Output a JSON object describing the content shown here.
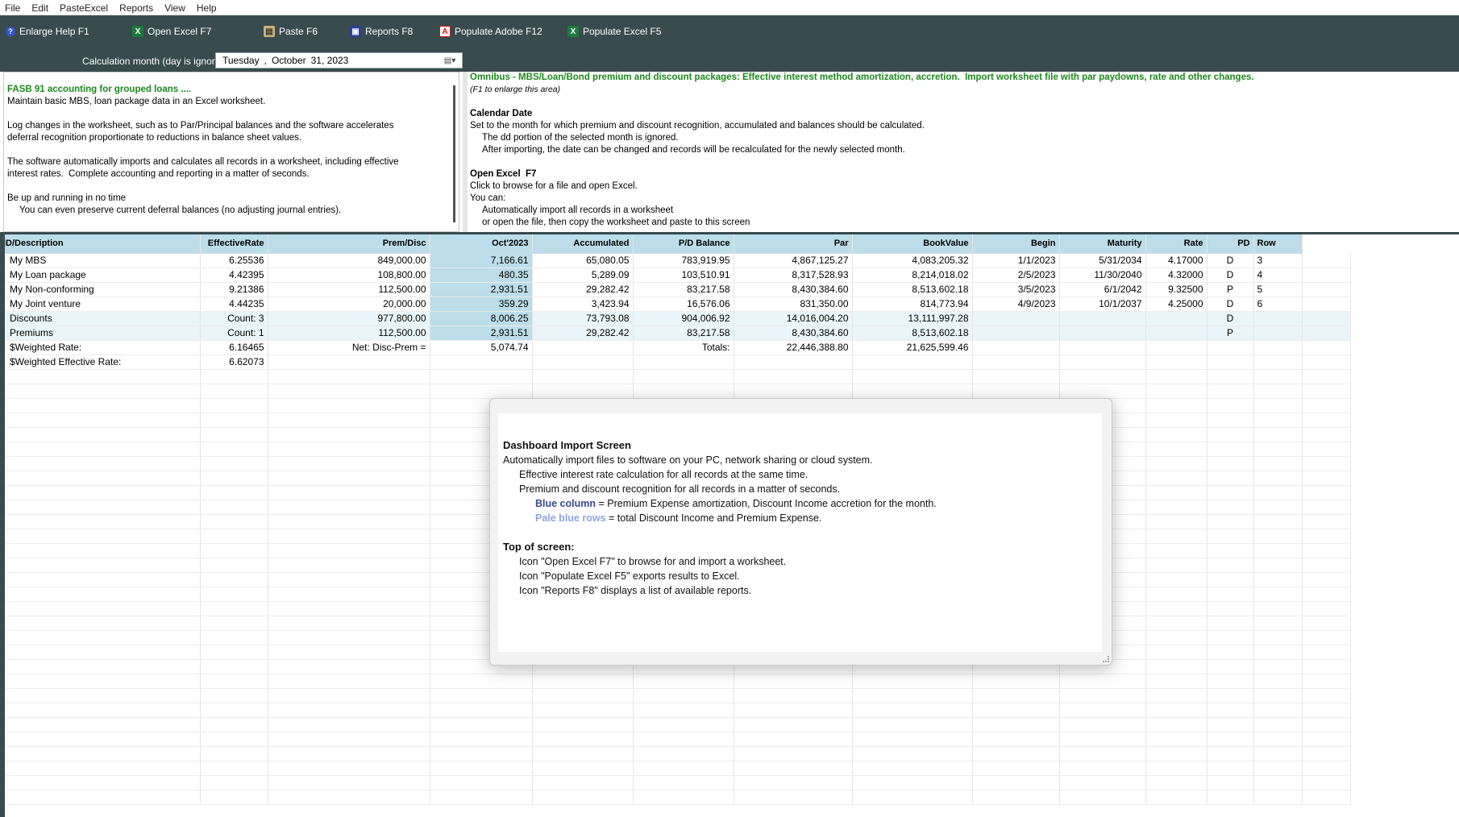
{
  "menu": [
    "File",
    "Edit",
    "PasteExcel",
    "Reports",
    "View",
    "Help"
  ],
  "toolbar": {
    "enlarge_help": "Enlarge Help  F1",
    "open_excel": "Open Excel  F7",
    "paste": "Paste  F6",
    "reports": "Reports  F8",
    "populate_adobe": "Populate Adobe  F12",
    "populate_excel": "Populate Excel  F5"
  },
  "calc": {
    "label": "Calculation month (day is ignored)",
    "weekday": "Tuesday",
    "sep": ",",
    "month": "October",
    "day_year": "31, 2023"
  },
  "left_help": {
    "title": "FASB 91 accounting for grouped loans ....",
    "l1": "Maintain basic MBS, loan package data in an Excel worksheet.",
    "l2": "Log changes in the worksheet, such as to Par/Principal balances and the software accelerates",
    "l3": "deferral recognition proportionate to reductions in balance sheet values.",
    "l4": "The software automatically imports and calculates all records in a worksheet, including effective",
    "l5": "interest rates.  Complete accounting and reporting in a matter of seconds.",
    "l6": "Be up and running in no time",
    "l7": "You can even preserve current deferral balances (no adjusting journal entries)."
  },
  "right_help": {
    "title": "Omnibus - MBS/Loan/Bond premium and discount packages: Effective interest method amortization, accretion.  Import worksheet file with par paydowns, rate and other changes.",
    "sub": "(F1 to enlarge this area)",
    "h1": "Calendar Date",
    "h1_l1": "Set to the month for which premium and discount recognition, accumulated and balances should be calculated.",
    "h1_l2": "The dd portion of the selected month is ignored.",
    "h1_l3": "After importing, the date can be changed and records will be recalculated for the newly selected month.",
    "h2": "Open Excel  F7",
    "h2_l1": "Click to browse for a file and open Excel.",
    "h2_l2": "You can:",
    "h2_l3": "Automatically import all records in a worksheet",
    "h2_l4": "or open the file, then copy the worksheet and paste to this screen"
  },
  "grid": {
    "headers": [
      "ID/Description",
      "EffectiveRate",
      "Prem/Disc",
      "Oct'2023",
      "Accumulated",
      "P/D Balance",
      "Par",
      "BookValue",
      "Begin",
      "Maturity",
      "Rate",
      "PD",
      "Row"
    ],
    "rows": [
      [
        "My MBS",
        "6.25536",
        "849,000.00",
        "7,166.61",
        "65,080.05",
        "783,919.95",
        "4,867,125.27",
        "4,083,205.32",
        "1/1/2023",
        "5/31/2034",
        "4.17000",
        "D",
        "3"
      ],
      [
        "My Loan package",
        "4.42395",
        "108,800.00",
        "480.35",
        "5,289.09",
        "103,510.91",
        "8,317,528.93",
        "8,214,018.02",
        "2/5/2023",
        "11/30/2040",
        "4.32000",
        "D",
        "4"
      ],
      [
        "My Non-conforming",
        "9.21386",
        "112,500.00",
        "2,931.51",
        "29,282.42",
        "83,217.58",
        "8,430,384.60",
        "8,513,602.18",
        "3/5/2023",
        "6/1/2042",
        "9.32500",
        "P",
        "5"
      ],
      [
        "My Joint venture",
        "4.44235",
        "20,000.00",
        "359.29",
        "3,423.94",
        "16,576.06",
        "831,350.00",
        "814,773.94",
        "4/9/2023",
        "10/1/2037",
        "4.25000",
        "D",
        "6"
      ]
    ],
    "summary": [
      [
        "Discounts",
        "Count: 3",
        "977,800.00",
        "8,006.25",
        "73,793.08",
        "904,006.92",
        "14,016,004.20",
        "13,111,997.28",
        "",
        "",
        "",
        "D",
        ""
      ],
      [
        "Premiums",
        "Count: 1",
        "112,500.00",
        "2,931.51",
        "29,282.42",
        "83,217.58",
        "8,430,384.60",
        "8,513,602.18",
        "",
        "",
        "",
        "P",
        ""
      ]
    ],
    "weighted_rate_label": "$Weighted Rate:",
    "weighted_rate": "6.16465",
    "net_label": "Net: Disc-Prem =",
    "net_value": "5,074.74",
    "totals_label": "Totals:",
    "totals_par": "22,446,388.80",
    "totals_book": "21,625,599.46",
    "weighted_eff_label": "$Weighted Effective Rate:",
    "weighted_eff": "6.62073"
  },
  "popup": {
    "title": "Dashboard Import Screen",
    "l1": "Automatically import files to software on your PC, network sharing or cloud system.",
    "l2": "Effective interest rate calculation for all records at the same time.",
    "l3": "Premium and discount recognition for all records in a matter of seconds.",
    "blue_label": "Blue column",
    "blue_text": " = Premium Expense amortization, Discount Income accretion for the month.",
    "pale_label": "Pale blue rows",
    "pale_text": " = total Discount Income and Premium Expense.",
    "top_title": "Top of screen:",
    "t1": "Icon \"Open Excel F7\" to browse for and import a worksheet.",
    "t2": "Icon \"Populate Excel F5\" exports results to Excel.",
    "t3": "Icon \"Reports F8\" displays a list of available reports."
  },
  "colors": {
    "toolbar_bg": "#384b4f",
    "grid_header": "#bcdde9",
    "pale_row": "#e9f5f8",
    "help_green": "#1a8a1a"
  }
}
